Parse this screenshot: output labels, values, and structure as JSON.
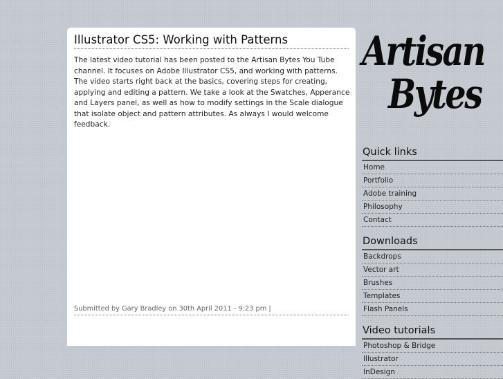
{
  "post": {
    "title": "Illustrator CS5: Working with Patterns",
    "body": "The latest video tutorial has been posted to the Artisan Bytes You Tube channel. It focuses on Adobe Illustrator CS5, and working with patterns. The video starts right back at the basics, covering steps for creating, applying and editing a pattern. We take a look at the Swatches, Apperance and Layers panel, as well as how to modify settings in the Scale dialogue that isolate object and pattern attributes. As always I would welcome feedback.",
    "meta": "Submitted by Gary Bradley on 30th April 2011 - 9:23 pm |"
  },
  "logo": {
    "line1": "Artisan",
    "line2": "Bytes"
  },
  "sidebar": {
    "quick_links": {
      "title": "Quick links",
      "items": [
        "Home",
        "Portfolio",
        "Adobe training",
        "Philosophy",
        "Contact"
      ]
    },
    "downloads": {
      "title": "Downloads",
      "items": [
        "Backdrops",
        "Vector art",
        "Brushes",
        "Templates",
        "Flash Panels"
      ]
    },
    "video_tutorials": {
      "title": "Video tutorials",
      "items": [
        "Photoshop & Bridge",
        "Illustrator",
        "InDesign"
      ]
    }
  }
}
